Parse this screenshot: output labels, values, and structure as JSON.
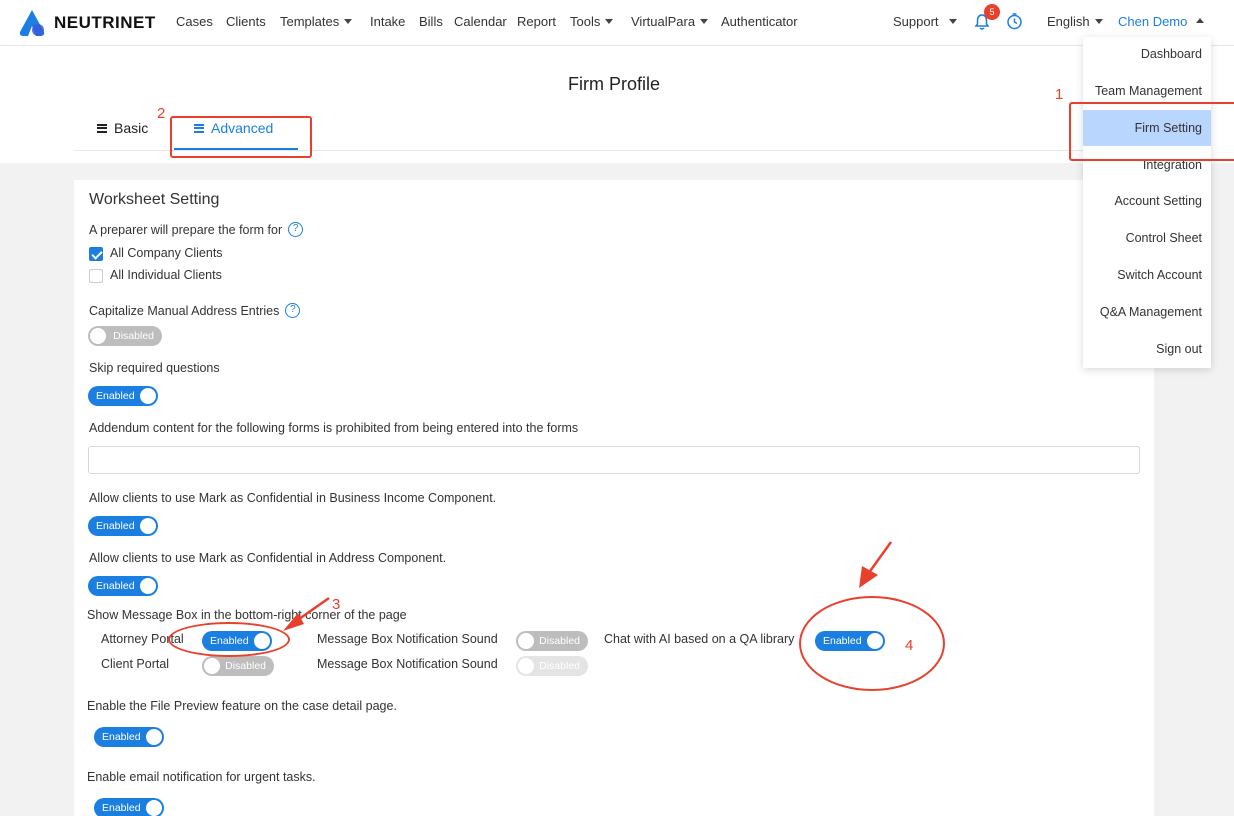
{
  "brand": {
    "name": "NEUTRINET",
    "logo_color": "#1a7fe0"
  },
  "nav": {
    "items": [
      {
        "label": "Cases"
      },
      {
        "label": "Clients"
      },
      {
        "label": "Templates"
      },
      {
        "label": "Intake"
      },
      {
        "label": "Bills"
      },
      {
        "label": "Calendar"
      },
      {
        "label": "Report"
      },
      {
        "label": "Tools"
      },
      {
        "label": "VirtualPara"
      },
      {
        "label": "Authenticator"
      }
    ],
    "support": "Support",
    "notification_count": "5",
    "language": "English",
    "user": "Chen Demo"
  },
  "user_menu": {
    "items": [
      "Dashboard",
      "Team Management",
      "Firm Setting",
      "Integration",
      "Account Setting",
      "Control Sheet",
      "Switch Account",
      "Q&A Management",
      "Sign out"
    ],
    "selected": "Firm Setting"
  },
  "page": {
    "title": "Firm Profile",
    "tabs": [
      {
        "label": "Basic"
      },
      {
        "label": "Advanced"
      }
    ],
    "active_tab": "Advanced"
  },
  "worksheet": {
    "section_title": "Worksheet Setting",
    "preparer_label": "A preparer will prepare the form for",
    "opt_company": "All Company Clients",
    "opt_individual": "All Individual Clients",
    "capitalize_label": "Capitalize Manual Address Entries",
    "skip_label": "Skip required questions",
    "addendum_label": "Addendum content for the following forms is prohibited from being entered into the forms",
    "addendum_value": "",
    "conf_business_label": "Allow clients to use Mark as Confidential in Business Income Component.",
    "conf_address_label": "Allow clients to use Mark as Confidential in Address Component.",
    "msgbox_label": "Show Message Box in the bottom-right corner of the page",
    "attorney_portal": "Attorney Portal",
    "client_portal": "Client Portal",
    "notif_sound": "Message Box Notification Sound",
    "chat_ai": "Chat with AI based on a QA library",
    "file_preview_label": "Enable the File Preview feature on the case detail page.",
    "email_notif_label": "Enable email notification for urgent tasks."
  },
  "toggle_text": {
    "on": "Enabled",
    "off": "Disabled"
  },
  "annotations": {
    "n1": "1",
    "n2": "2",
    "n3": "3",
    "n4": "4",
    "color": "#e8402c"
  }
}
